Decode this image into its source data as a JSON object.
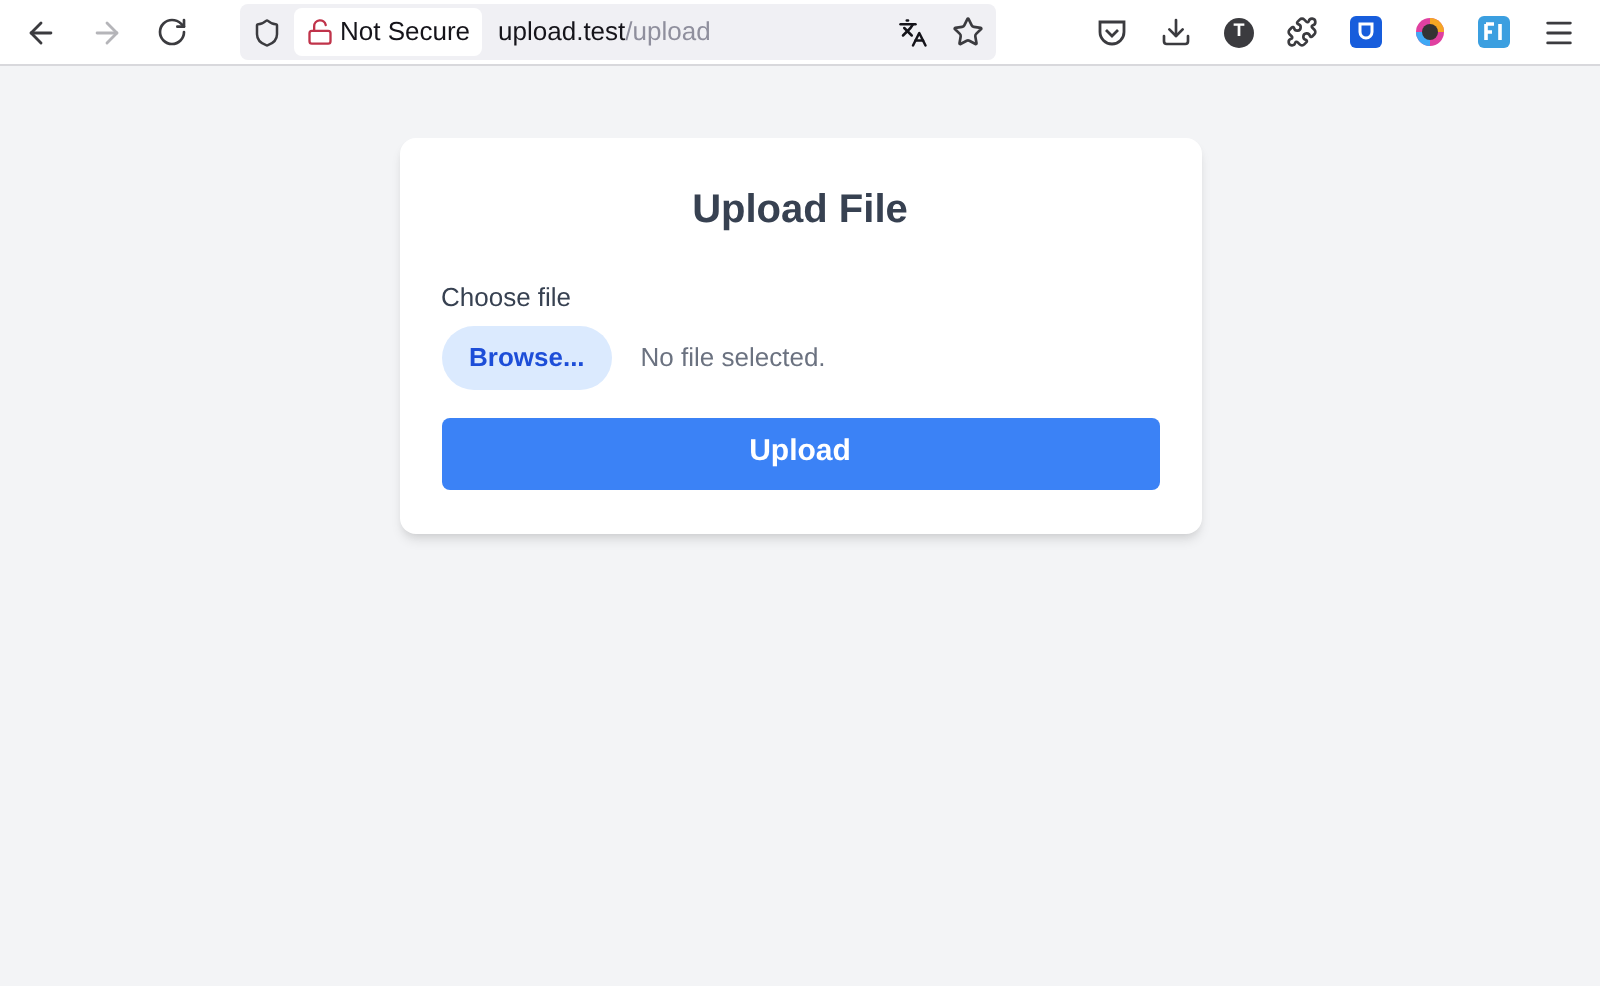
{
  "browser": {
    "security_label": "Not Secure",
    "url_host": "upload.test",
    "url_path": "/upload",
    "account_initial": "T"
  },
  "card": {
    "title": "Upload File",
    "field_label": "Choose file",
    "browse_button": "Browse...",
    "file_status": "No file selected.",
    "submit_button": "Upload"
  }
}
